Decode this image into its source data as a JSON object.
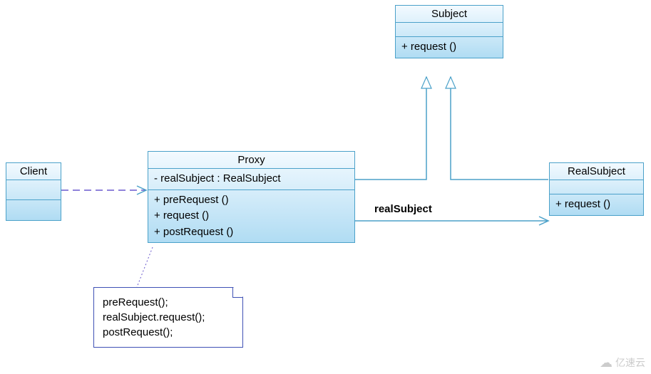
{
  "classes": {
    "subject": {
      "name": "Subject",
      "ops": [
        "+ request ()"
      ]
    },
    "client": {
      "name": "Client"
    },
    "proxy": {
      "name": "Proxy",
      "attrs": [
        "- realSubject : RealSubject"
      ],
      "ops": [
        "+ preRequest ()",
        "+ request ()",
        "+ postRequest ()"
      ]
    },
    "realsubject": {
      "name": "RealSubject",
      "ops": [
        "+ request ()"
      ]
    }
  },
  "assoc_label": "realSubject",
  "note_lines": [
    "preRequest();",
    "realSubject.request();",
    "postRequest();"
  ],
  "watermark": "亿速云"
}
